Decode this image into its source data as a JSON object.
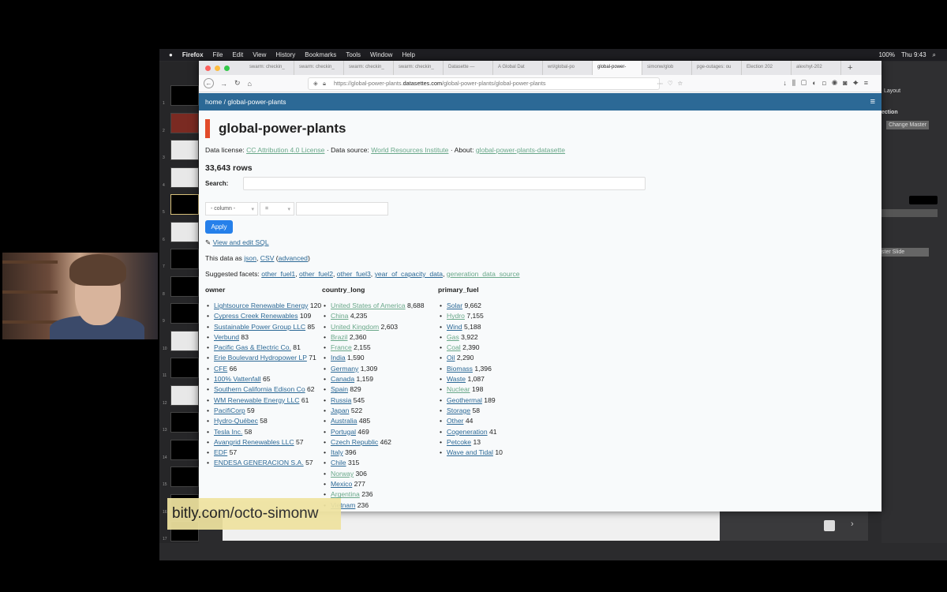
{
  "menubar": {
    "app": "Firefox",
    "items": [
      "File",
      "Edit",
      "View",
      "History",
      "Bookmarks",
      "Tools",
      "Window",
      "Help"
    ],
    "battery": "100%",
    "clock": "Thu 9:43"
  },
  "tabs": [
    "swarm: checkin_",
    "swarm: checkin_",
    "swarm: checkin_",
    "swarm: checkin_",
    "Datasette —",
    "A Global Dat",
    "wri/global-po",
    "global-power-",
    "simonw/glob",
    "pge-outages: ou",
    "Election 202",
    "alex/nyt-202"
  ],
  "active_tab_index": 7,
  "url": {
    "prefix": "https://global-power-plants.",
    "domain": "datasettes.com",
    "path": "/global-power-plants/global-power-plants"
  },
  "breadcrumb": "home / global-power-plants",
  "title": "global-power-plants",
  "meta": {
    "license_label": "Data license:",
    "license": "CC Attribution 4.0 License",
    "source_label": "Data source:",
    "source": "World Resources Institute",
    "about_label": "About:",
    "about": "global-power-plants-datasette",
    "sep": " · "
  },
  "rows": "33,643 rows",
  "search_label": "Search:",
  "filter": {
    "column": "- column -",
    "op": "=",
    "value": ""
  },
  "apply": "Apply",
  "sql_link": "View and edit SQL",
  "export": {
    "prefix": "This data as ",
    "json": "json",
    "csv": "CSV",
    "advanced": "advanced"
  },
  "suggested": {
    "label": "Suggested facets:",
    "items": [
      "other_fuel1",
      "other_fuel2",
      "other_fuel3",
      "year_of_capacity_data",
      "generation_data_source"
    ]
  },
  "facets": [
    {
      "name": "owner",
      "items": [
        [
          "Lightsource Renewable Energy",
          "120"
        ],
        [
          "Cypress Creek Renewables",
          "109"
        ],
        [
          "Sustainable Power Group LLC",
          "85"
        ],
        [
          "Verbund",
          "83"
        ],
        [
          "Pacific Gas & Electric Co.",
          "81"
        ],
        [
          "Erie Boulevard Hydropower LP",
          "71"
        ],
        [
          "CFE",
          "66"
        ],
        [
          "100% Vattenfall",
          "65"
        ],
        [
          "Southern California Edison Co",
          "62"
        ],
        [
          "WM Renewable Energy LLC",
          "61"
        ],
        [
          "PacifiCorp",
          "59"
        ],
        [
          "Hydro-Québec",
          "58"
        ],
        [
          "Tesla Inc.",
          "58"
        ],
        [
          "Avangrid Renewables LLC",
          "57"
        ],
        [
          "EDF",
          "57"
        ],
        [
          "ENDESA GENERACION S.A.",
          "57"
        ]
      ]
    },
    {
      "name": "country_long",
      "items": [
        [
          "United States of America",
          "8,688"
        ],
        [
          "China",
          "4,235"
        ],
        [
          "United Kingdom",
          "2,603"
        ],
        [
          "Brazil",
          "2,360"
        ],
        [
          "France",
          "2,155"
        ],
        [
          "India",
          "1,590"
        ],
        [
          "Germany",
          "1,309"
        ],
        [
          "Canada",
          "1,159"
        ],
        [
          "Spain",
          "829"
        ],
        [
          "Russia",
          "545"
        ],
        [
          "Japan",
          "522"
        ],
        [
          "Australia",
          "485"
        ],
        [
          "Portugal",
          "469"
        ],
        [
          "Czech Republic",
          "462"
        ],
        [
          "Italy",
          "396"
        ],
        [
          "Chile",
          "315"
        ],
        [
          "Norway",
          "306"
        ],
        [
          "Mexico",
          "277"
        ],
        [
          "Argentina",
          "236"
        ],
        [
          "Vietnam",
          "236"
        ]
      ]
    },
    {
      "name": "primary_fuel",
      "items": [
        [
          "Solar",
          "9,662"
        ],
        [
          "Hydro",
          "7,155"
        ],
        [
          "Wind",
          "5,188"
        ],
        [
          "Gas",
          "3,922"
        ],
        [
          "Coal",
          "2,390"
        ],
        [
          "Oil",
          "2,290"
        ],
        [
          "Biomass",
          "1,396"
        ],
        [
          "Waste",
          "1,087"
        ],
        [
          "Nuclear",
          "198"
        ],
        [
          "Geothermal",
          "189"
        ],
        [
          "Storage",
          "58"
        ],
        [
          "Other",
          "44"
        ],
        [
          "Cogeneration",
          "41"
        ],
        [
          "Petcoke",
          "13"
        ],
        [
          "Wave and Tidal",
          "10"
        ]
      ]
    }
  ],
  "inspector": {
    "layout": "Layout",
    "section": "ection",
    "change_master": "Change Master",
    "master_slide": "ster Slide"
  },
  "slide_numbers": [
    "1",
    "2",
    "3",
    "4",
    "5",
    "6",
    "7",
    "8",
    "9",
    "10",
    "11",
    "12",
    "13",
    "14",
    "15",
    "16",
    "17"
  ],
  "caption": "bitly.com/octo-simonw",
  "colors": {
    "header": "#2c6996",
    "accent": "#e24b2a",
    "apply": "#2680ea",
    "link": "#2c6996"
  }
}
